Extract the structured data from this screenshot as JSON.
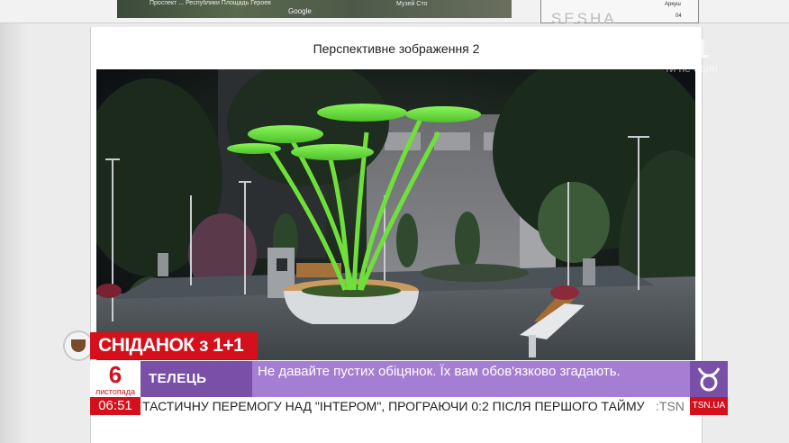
{
  "document": {
    "map_labels": [
      "Проспект ... Республики Площадь Героев",
      "Google",
      "Музей Сто"
    ],
    "sheet_label": "Аркуш",
    "sheet_number": "04",
    "brand_mark": "SESHA",
    "page_title": "Перспективне зображення 2"
  },
  "watermark": {
    "logo": "1+1",
    "subtitle": "ти не один"
  },
  "show": {
    "logo_text": "СНІДАНОК з 1+1"
  },
  "horoscope": {
    "day": "6",
    "month": "листопада",
    "sign": "ТЕЛЕЦЬ",
    "message": "Не давайте пустих обіцянок. Їх вам обов'язково згадають.",
    "sign_icon": "taurus-icon"
  },
  "ticker": {
    "time": "06:51",
    "text": "ТАСТИЧНУ ПЕРЕМОГУ НАД \"ІНТЕРОМ\", ПРОГРАЮЧИ 0:2 ПІСЛЯ ПЕРШОГО ТАЙМУ",
    "tail": ":TSN",
    "brand": "TSN.UA"
  },
  "colors": {
    "accent_red": "#d4101c",
    "horoscope_dark": "#7a4fa8",
    "horoscope_light": "#a57ed3",
    "tree_glow": "#6fe03a"
  }
}
